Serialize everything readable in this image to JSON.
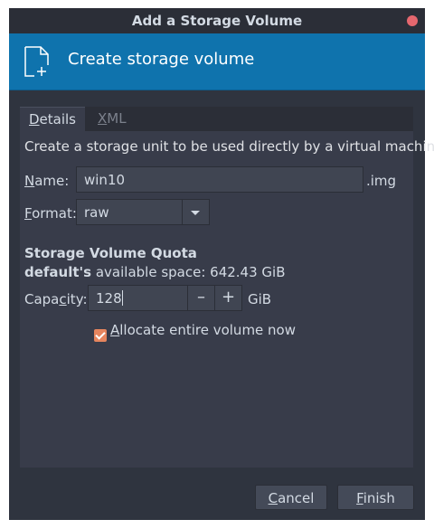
{
  "window": {
    "title": "Add a Storage Volume"
  },
  "banner": {
    "title": "Create storage volume",
    "icon": "new-document-icon"
  },
  "tabs": [
    {
      "label": "Details",
      "access_key": "D",
      "selected": true
    },
    {
      "label": "XML",
      "access_key": "X",
      "selected": false
    }
  ],
  "details": {
    "description": "Create a storage unit to be used directly by a virtual machine.",
    "name_label_pre": "",
    "name_label_key": "N",
    "name_label_post": "ame:",
    "name_value": "win10",
    "name_suffix": ".img",
    "format_label_key": "F",
    "format_label_post": "ormat:",
    "format_value": "raw",
    "quota_heading": "Storage Volume Quota",
    "pool_name": "default's",
    "available_text": " available space: 642.43 GiB",
    "capacity_label_pre": "Capa",
    "capacity_label_key": "c",
    "capacity_label_post": "ity:",
    "capacity_value": "128",
    "capacity_unit": "GiB",
    "decrement_symbol": "–",
    "increment_symbol": "+",
    "allocate_label_key": "A",
    "allocate_label_post": "llocate entire volume now",
    "allocate_checked": true
  },
  "buttons": {
    "cancel_key": "C",
    "cancel_post": "ancel",
    "finish_key": "F",
    "finish_post": "inish"
  },
  "colors": {
    "banner": "#0f73ad",
    "window_bg": "#2f343f",
    "panel_bg": "#383c4a",
    "close_button": "#e5676e",
    "checkbox_accent": "#e6855e"
  }
}
